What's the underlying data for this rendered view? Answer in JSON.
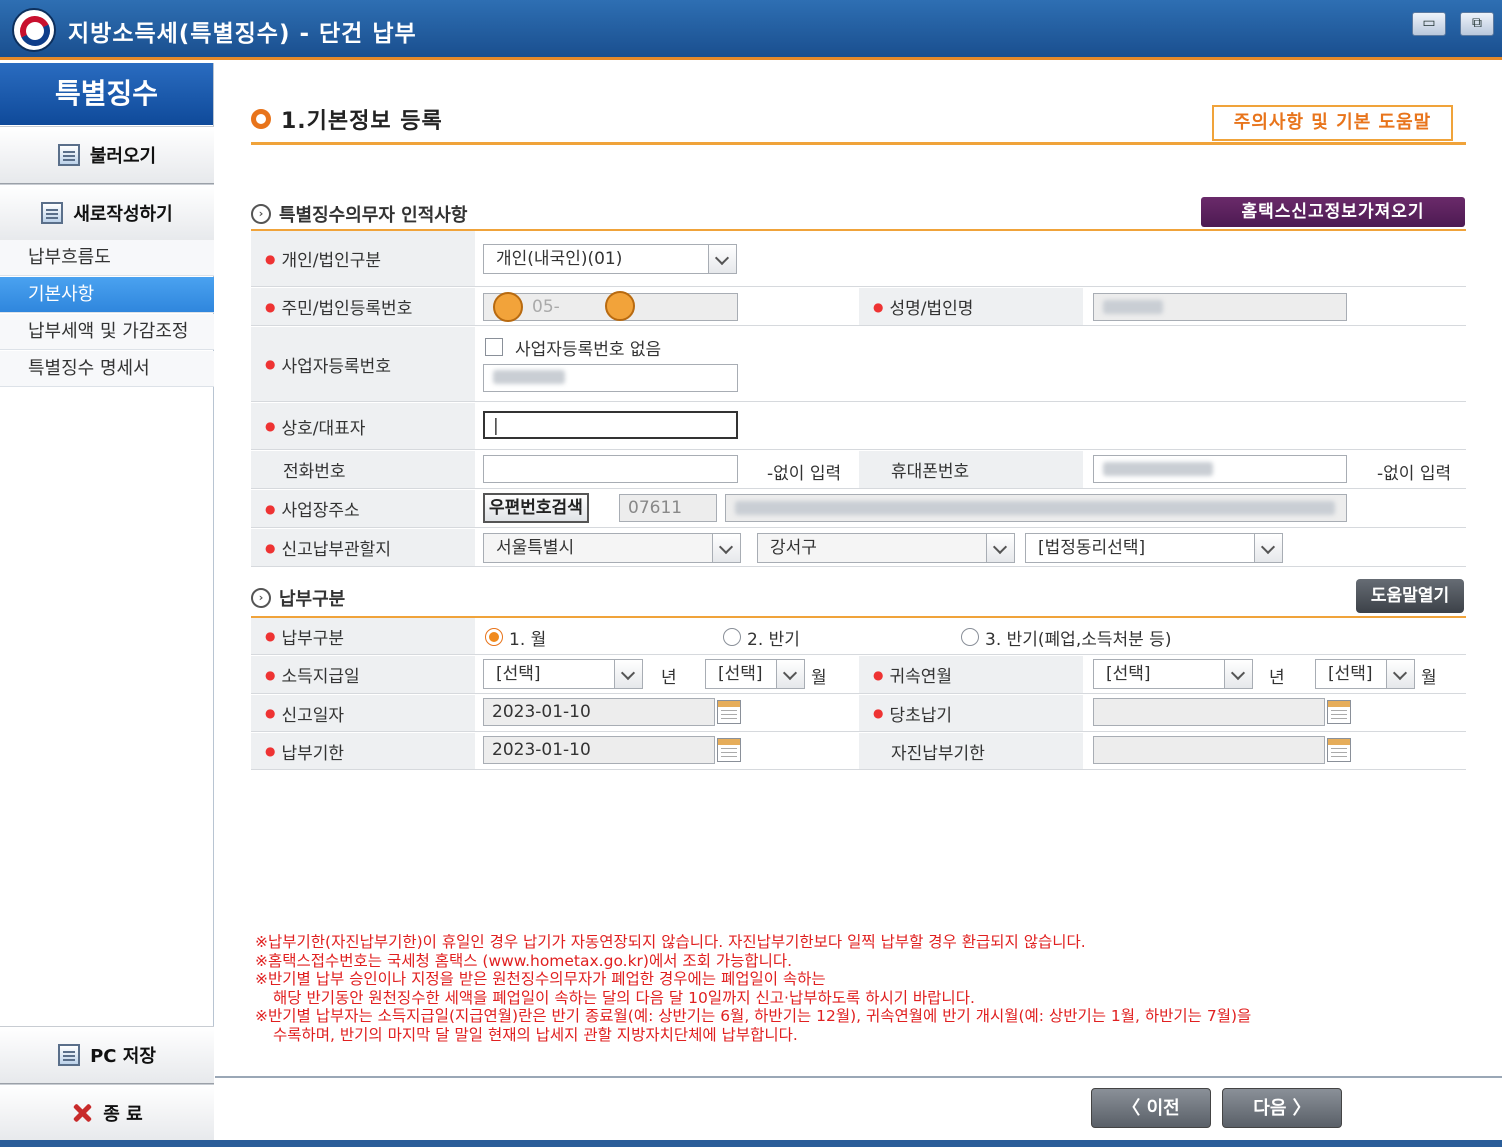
{
  "window": {
    "title": "지방소득세(특별징수) - 단건 납부",
    "minimize": "▭",
    "restore": "⧉"
  },
  "sidebar": {
    "header": "특별징수",
    "load_button": "불러오기",
    "new_button": "새로작성하기",
    "items": [
      {
        "label": "납부흐름도"
      },
      {
        "label": "기본사항"
      },
      {
        "label": "납부세액 및 가감조정"
      },
      {
        "label": "특별징수 명세서"
      }
    ],
    "save_button": "PC 저장",
    "exit_button": "종 료"
  },
  "main": {
    "section_title": "1.기본정보 등록",
    "help_button": "주의사항 및 기본 도움말",
    "taxpayer": {
      "heading": "특별징수의무자 인적사항",
      "fetch_button": "홈택스신고정보가져오기",
      "type_label": "개인/법인구분",
      "type_value": "개인(내국인)(01)",
      "regno_label": "주민/법인등록번호",
      "regno_value": "05-",
      "name_label": "성명/법인명",
      "bizno_label": "사업자등록번호",
      "no_bizno_label": "사업자등록번호 없음",
      "company_label": "상호/대표자",
      "company_value": "|",
      "phone_label": "전화번호",
      "phone_hint": "-없이 입력",
      "mobile_label": "휴대폰번호",
      "mobile_hint": "-없이 입력",
      "address_label": "사업장주소",
      "zip_button": "우편번호검색",
      "zip_value": "07611",
      "jurisdiction_label": "신고납부관할지",
      "city": "서울특별시",
      "district": "강서구",
      "dong": "[법정동리선택]"
    },
    "payment": {
      "heading": "납부구분",
      "help_open": "도움말열기",
      "kind_label": "납부구분",
      "option1": "1. 월",
      "option2": "2. 반기",
      "option3": "3. 반기(폐업,소득처분 등)",
      "income_date_label": "소득지급일",
      "select_placeholder": "[선택]",
      "year_unit": "년",
      "month_unit": "월",
      "attribution_label": "귀속연월",
      "report_date_label": "신고일자",
      "report_date": "2023-01-10",
      "original_due_label": "당초납기",
      "due_label": "납부기한",
      "due_date": "2023-01-10",
      "voluntary_due_label": "자진납부기한"
    },
    "notes": [
      "※납부기한(자진납부기한)이 휴일인 경우 납기가 자동연장되지 않습니다. 자진납부기한보다 일찍 납부할 경우 환급되지 않습니다.",
      "※홈택스접수번호는 국세청 홈택스 (www.hometax.go.kr)에서 조회 가능합니다.",
      "※반기별 납부 승인이나 지정을 받은 원천징수의무자가 폐업한 경우에는 폐업일이 속하는",
      "해당 반기동안 원천징수한 세액을 폐업일이 속하는 달의 다음 달 10일까지 신고·납부하도록 하시기 바랍니다.",
      "※반기별 납부자는 소득지급일(지급연월)란은 반기 종료월(예: 상반기는 6월, 하반기는 12월), 귀속연월에 반기 개시월(예: 상반기는 1월, 하반기는 7월)을",
      "수록하며, 반기의 마지막 달 말일 현재의 납세지 관할 지방자치단체에 납부합니다."
    ],
    "prev_button": "〈 이전",
    "next_button": "다음 〉"
  }
}
